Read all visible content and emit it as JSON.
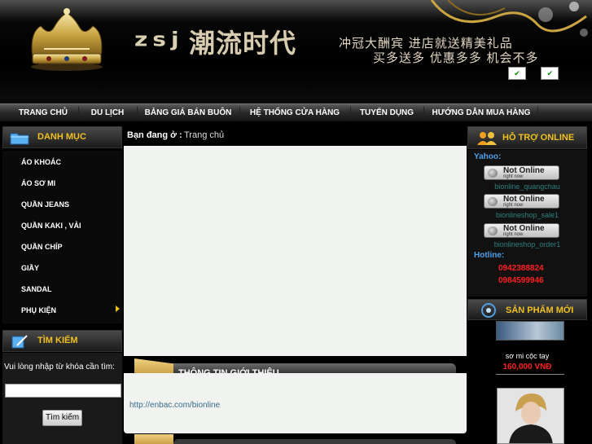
{
  "banner": {
    "brand_latin": "zsj",
    "brand_cjk": "潮流时代",
    "slogan_line1": "冲冠大酬宾 进店就送精美礼品",
    "slogan_line2": "买多送多 优惠多多 机会不多"
  },
  "nav": {
    "items": [
      {
        "label": "TRANG CHỦ"
      },
      {
        "label": "DU LỊCH"
      },
      {
        "label": "BẢNG GIÁ BÁN BUÔN"
      },
      {
        "label": "HỆ THỐNG CỬA HÀNG"
      },
      {
        "label": "TUYỂN DỤNG"
      },
      {
        "label": "HƯỚNG DẪN MUA HÀNG"
      }
    ]
  },
  "sidebar": {
    "category_title": "DANH MỤC",
    "items": [
      {
        "label": "ÁO KHOÁC"
      },
      {
        "label": "ÁO SƠ MI"
      },
      {
        "label": "QUẦN JEANS"
      },
      {
        "label": "QUẦN KAKI , VẢI"
      },
      {
        "label": "QUẦN CHÍP"
      },
      {
        "label": "GIẦY"
      },
      {
        "label": "SANDAL"
      },
      {
        "label": "PHỤ KIỆN"
      }
    ],
    "search_title": "TÌM KIẾM",
    "search_label": "Vui lòng nhập từ khóa cần tìm:",
    "search_value": "",
    "search_button": "Tìm kiếm"
  },
  "main": {
    "breadcrumb_label": "Bạn đang ở :",
    "breadcrumb_current": "Trang chủ",
    "intro_title": "THÔNG TIN GIỚI THIỆU",
    "intro_link": "http://enbac.com/bionline"
  },
  "support": {
    "title": "HỖ TRỢ ONLINE",
    "yahoo_label": "Yahoo:",
    "status_line1": "Not Online",
    "status_line2": "right now",
    "yahoo_ids": [
      "bionline_quangchau",
      "bionlineshop_sale1",
      "bionlineshop_order1"
    ],
    "hotline_label": "Hotline:",
    "phones": [
      "0942388824",
      "0984599946"
    ]
  },
  "products": {
    "title": "SẢN PHẨM MỚI",
    "items": [
      {
        "name": "sơ mi cộc tay",
        "price": "160,000 VNĐ"
      }
    ]
  },
  "colors": {
    "heading_gold": "#f0c020",
    "link_blue": "#4ea0e6",
    "price_red": "#ff2020",
    "panel_bg": "#f1f3f1"
  }
}
